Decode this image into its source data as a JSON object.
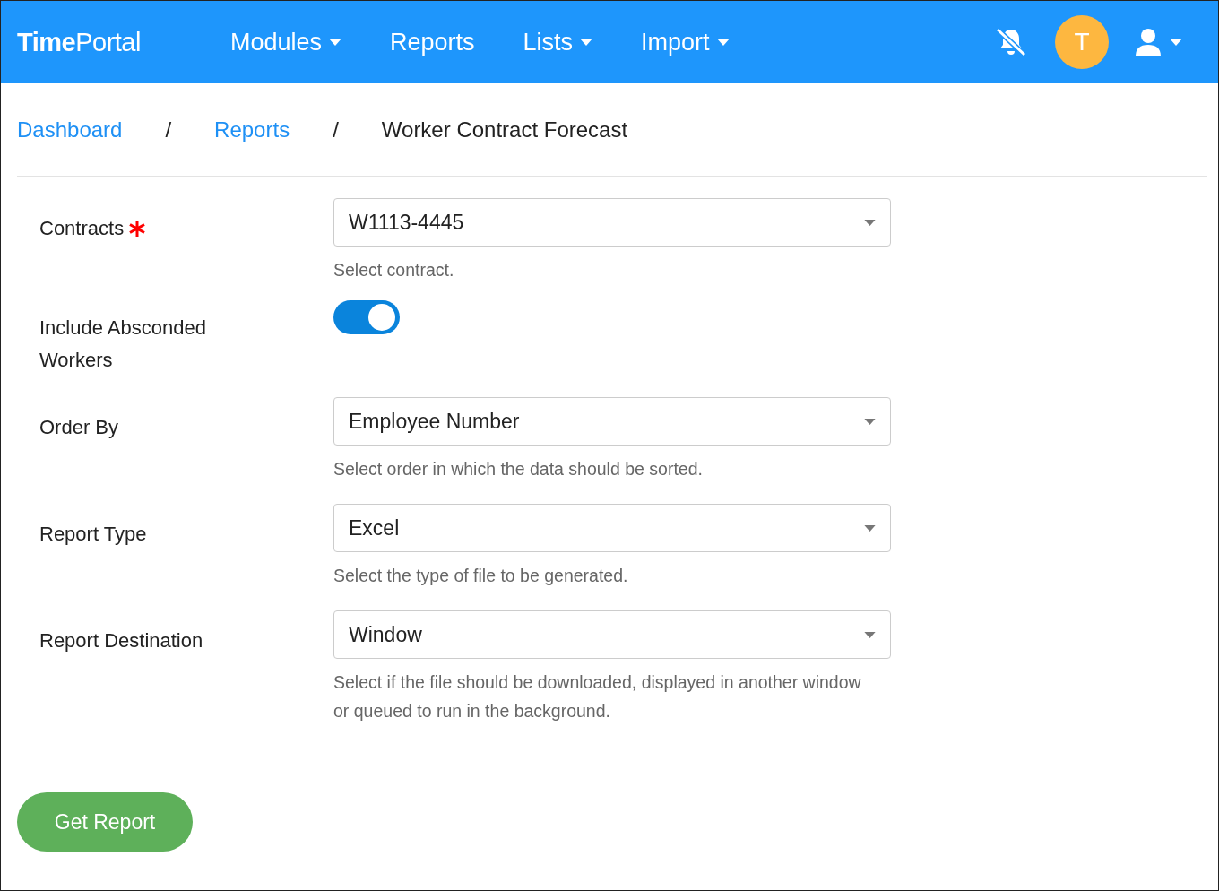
{
  "navbar": {
    "brand": "**Time**Portal",
    "menu": [
      {
        "label": "Modules",
        "dropdown": true
      },
      {
        "label": "Reports",
        "dropdown": false
      },
      {
        "label": "Lists",
        "dropdown": true
      },
      {
        "label": "Import",
        "dropdown": true
      }
    ],
    "notifications_muted": true,
    "avatar": "T"
  },
  "breadcrumb": [
    {
      "label": "Dashboard",
      "link": true
    },
    {
      "label": "Reports",
      "link": true
    },
    {
      "label": "Worker Contract Forecast",
      "link": false
    }
  ],
  "breadcrumb_separators": [
    "/",
    "/"
  ],
  "fields": [
    {
      "kind": "select",
      "label": "Contracts",
      "required": true,
      "value": "W1113-4445",
      "help": "Select contract."
    },
    {
      "kind": "toggle",
      "label": "Include Absconded Workers",
      "required": false,
      "on": true
    },
    {
      "kind": "select",
      "label": "Order By",
      "required": false,
      "value": "Employee Number",
      "help": "Select order in which the data should be sorted."
    },
    {
      "kind": "select",
      "label": "Report Type",
      "required": false,
      "value": "Excel",
      "help": "Select the type of file to be generated."
    },
    {
      "kind": "select",
      "label": "Report Destination",
      "required": false,
      "value": "Window",
      "help": "Select if the file should be downloaded, displayed in another window or queued to run in the background."
    }
  ],
  "submit": "Get Report"
}
